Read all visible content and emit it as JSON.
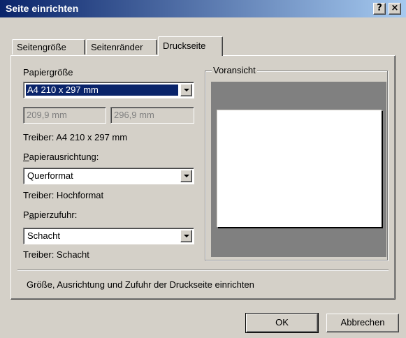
{
  "window": {
    "title": "Seite einrichten",
    "help_button": "?",
    "close_button": "×"
  },
  "tabs": [
    {
      "label": "Seitengröße",
      "active": false
    },
    {
      "label": "Seitenränder",
      "active": false
    },
    {
      "label": "Druckseite",
      "active": true
    }
  ],
  "paper_size": {
    "label": "Papiergröße",
    "value": "A4 210 x 297 mm",
    "width_value": "209,9 mm",
    "height_value": "296,9 mm",
    "driver_text": "Treiber: A4 210 x 297 mm"
  },
  "orientation": {
    "label_underlined": "P",
    "label_rest": "apierausrichtung:",
    "value": "Querformat",
    "driver_text": "Treiber: Hochformat"
  },
  "paper_source": {
    "label_prefix": "P",
    "label_underlined": "a",
    "label_rest": "pierzufuhr:",
    "value": "Schacht",
    "driver_text": "Treiber: Schacht"
  },
  "preview": {
    "label": "Voransicht"
  },
  "description": "Größe, Ausrichtung und Zufuhr der Druckseite einrichten",
  "buttons": {
    "ok": "OK",
    "cancel": "Abbrechen"
  },
  "colors": {
    "titlebar_start": "#0a246a",
    "titlebar_end": "#a6caf0",
    "dialog_face": "#d4d0c8",
    "selection": "#0a246a",
    "preview_background": "#808080"
  }
}
